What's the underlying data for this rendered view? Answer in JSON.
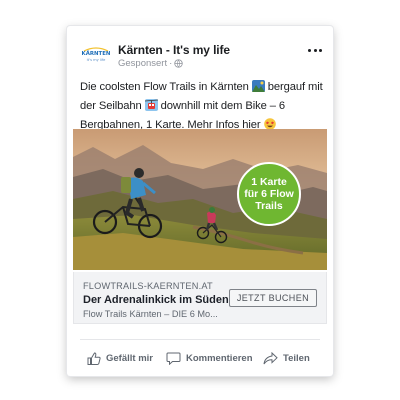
{
  "post": {
    "page_name": "Kärnten - It's my life",
    "sponsored_label": "Gesponsert",
    "sponsored_separator": "·",
    "text_parts": [
      "Die coolsten Flow Trails in Kärnten ",
      " bergauf mit der Seilbahn ",
      " downhill mit dem Bike – 6 Bergbahnen, 1 Karte. Mehr Infos hier "
    ],
    "emoji_icons": [
      "mountain-photo-icon",
      "cable-car-icon",
      "heart-eyes-icon"
    ]
  },
  "logo": {
    "text_top": "KÄRNTEN",
    "text_bottom": "it's my life"
  },
  "badge": {
    "line1": "1 Karte",
    "line2": "für 6 Flow",
    "line3": "Trails"
  },
  "link": {
    "domain": "FLOWTRAILS-KAERNTEN.AT",
    "title": "Der Adrenalinkick im Süden",
    "description": "Flow Trails Kärnten – DIE 6 Mo...",
    "cta": "JETZT BUCHEN"
  },
  "actions": {
    "like": "Gefällt mir",
    "comment": "Kommentieren",
    "share": "Teilen"
  },
  "colors": {
    "badge": "#6fb731",
    "text": "#1c1e21",
    "muted": "#606770",
    "link_bg": "#f2f3f5"
  }
}
